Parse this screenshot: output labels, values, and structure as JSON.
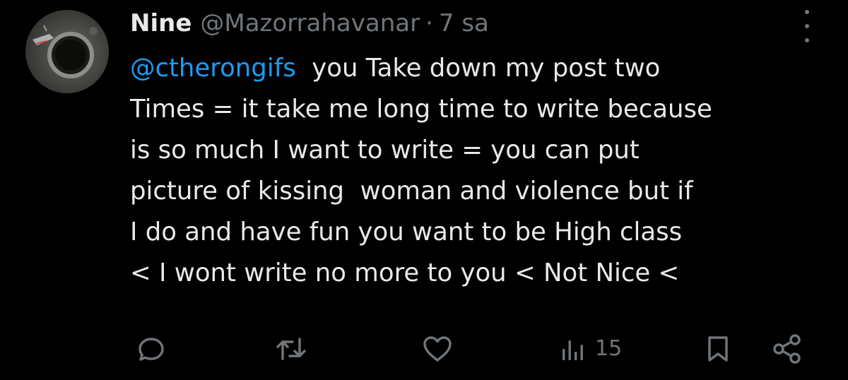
{
  "tweet": {
    "author": {
      "name": "Nine",
      "handle": "@Mazorrahavanar",
      "separator": "·",
      "time": "7 sa"
    },
    "text": {
      "mention": "@ctherongifs",
      "line1_rest": "  you Take down my post two",
      "line2": "Times = it take me long time to write because",
      "line3": "is so much I want to write = you can put",
      "line4": "picture of kissing  woman and violence but if",
      "line5": "I do and have fun you want to be High class",
      "line6": "< I wont write no more to you < Not Nice <"
    },
    "actions": {
      "views_count": "15"
    }
  },
  "icons": {
    "more": "more-vertical-icon",
    "reply": "reply-icon",
    "retweet": "retweet-icon",
    "like": "heart-icon",
    "views": "views-chart-icon",
    "bookmark": "bookmark-icon",
    "share": "share-icon"
  },
  "colors": {
    "background": "#000000",
    "text": "#e7e9ea",
    "secondary": "#71767b",
    "link": "#1d9bf0"
  }
}
